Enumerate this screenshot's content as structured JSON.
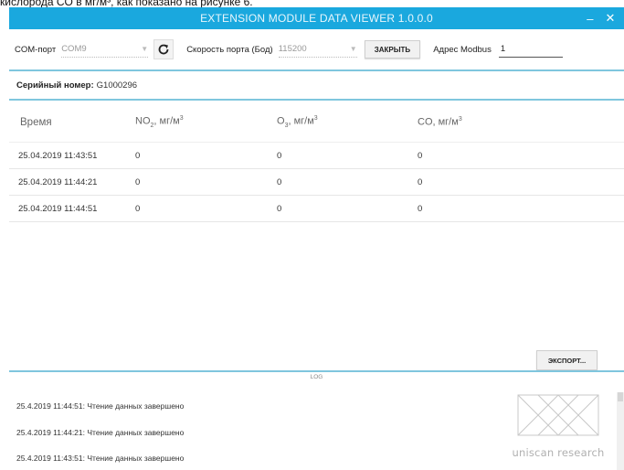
{
  "doc_fragment": "кислорода CO в мг/м³, как показано на рисунке 6.",
  "window": {
    "title": "EXTENSION MODULE DATA VIEWER 1.0.0.0",
    "minimize_glyph": "–",
    "close_glyph": "✕",
    "titlebar_color": "#1aa8de"
  },
  "toolbar": {
    "com_label": "COM-порт",
    "com_value": "COM9",
    "refresh_icon": "refresh-icon",
    "baud_label": "Скорость порта (Бод)",
    "baud_value": "115200",
    "close_button": "ЗАКРЫТЬ",
    "modbus_label": "Адрес Modbus",
    "modbus_value": "1"
  },
  "serial": {
    "label": "Серийный номер:",
    "value": "G1000296"
  },
  "table": {
    "headers": {
      "time": "Время",
      "no2_base": "NO",
      "no2_sub": "2",
      "no2_unit": ", мг/м",
      "no2_sup": "3",
      "o3_base": "O",
      "o3_sub": "3",
      "o3_unit": ", мг/м",
      "o3_sup": "3",
      "co_base": "CO, мг/м",
      "co_sup": "3"
    },
    "rows": [
      {
        "time": "25.04.2019 11:43:51",
        "no2": "0",
        "o3": "0",
        "co": "0"
      },
      {
        "time": "25.04.2019 11:44:21",
        "no2": "0",
        "o3": "0",
        "co": "0"
      },
      {
        "time": "25.04.2019 11:44:51",
        "no2": "0",
        "o3": "0",
        "co": "0"
      }
    ]
  },
  "export_button": "ЭКСПОРТ...",
  "log": {
    "title": "LOG",
    "lines": [
      "25.4.2019 11:44:51: Чтение данных завершено",
      "25.4.2019 11:44:21: Чтение данных завершено",
      "25.4.2019 11:43:51: Чтение данных завершено"
    ]
  },
  "logo": {
    "text": "uniscan research"
  }
}
